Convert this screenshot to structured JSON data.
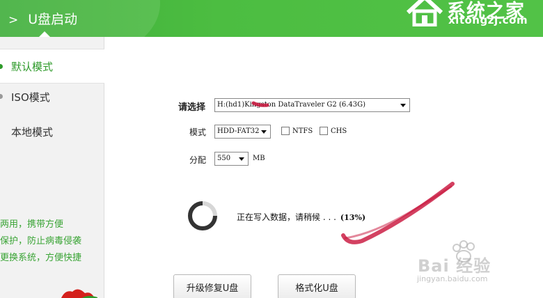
{
  "header": {
    "chevron": ">",
    "title": "U盘启动",
    "brand_cn": "系统之家",
    "brand_en": "xitongzj.com"
  },
  "sidebar": {
    "items": [
      {
        "label": "默认模式",
        "active": true
      },
      {
        "label": "ISO模式",
        "active": false
      },
      {
        "label": "本地模式",
        "active": false
      }
    ],
    "features": [
      "两用，携带方便",
      "保护，防止病毒侵袭",
      "更换系统，方便快捷"
    ]
  },
  "form": {
    "select_label": "请选择",
    "device_value": "H:(hd1)Kingston DataTraveler G2 (6.43G)",
    "mode_label": "模式",
    "mode_value": "HDD-FAT32",
    "ntfs_label": "NTFS",
    "ntfs_checked": false,
    "chs_label": "CHS",
    "chs_checked": false,
    "alloc_label": "分配",
    "alloc_value": "550",
    "alloc_unit": "MB"
  },
  "progress": {
    "status_text": "正在写入数据，请稍候 . . .",
    "percent_text": "(13%)",
    "percent": 13
  },
  "buttons": {
    "repair_label": "升级修复U盘",
    "format_label": "格式化U盘"
  },
  "watermark": {
    "text": "Bai 经验",
    "sub": "jingyan.baidu.com"
  },
  "colors": {
    "brand_green": "#4cbd41",
    "active_text": "#2e9a2a",
    "feature_text": "#3aa435",
    "annotation_red": "#c8123a"
  }
}
